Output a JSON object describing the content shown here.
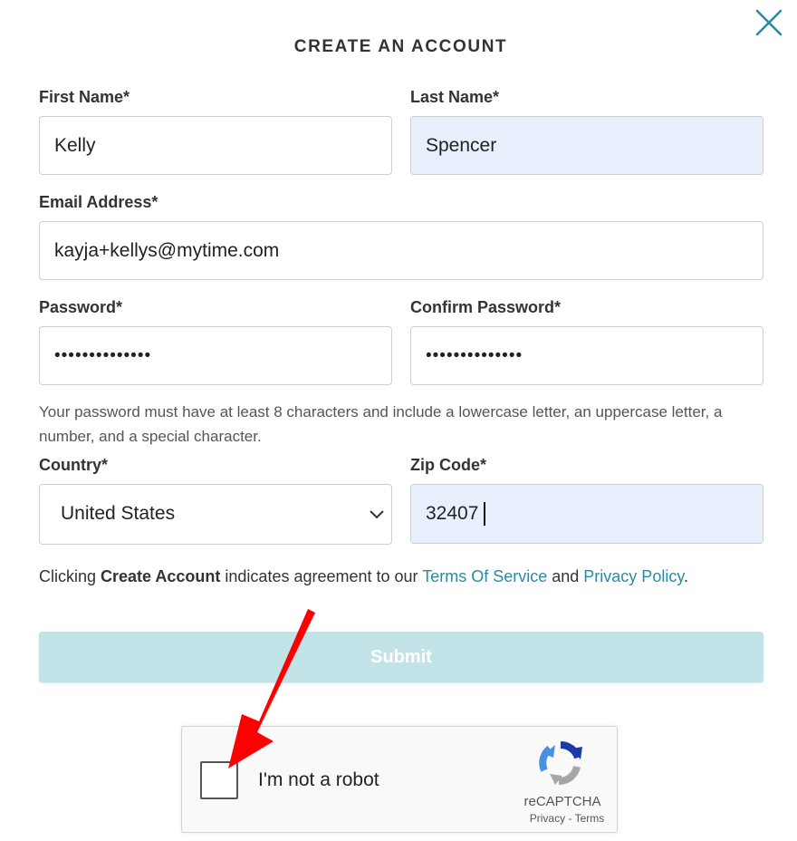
{
  "modal": {
    "title": "CREATE AN ACCOUNT",
    "close_icon": "close-icon"
  },
  "form": {
    "first_name": {
      "label": "First Name*",
      "value": "Kelly"
    },
    "last_name": {
      "label": "Last Name*",
      "value": "Spencer"
    },
    "email": {
      "label": "Email Address*",
      "value": "kayja+kellys@mytime.com"
    },
    "password": {
      "label": "Password*",
      "value": "••••••••••••••"
    },
    "confirm_password": {
      "label": "Confirm Password*",
      "value": "••••••••••••••"
    },
    "password_help": "Your password must have at least 8 characters and include a lowercase letter, an uppercase letter, a number, and a special character.",
    "country": {
      "label": "Country*",
      "value": "United States",
      "icon": "chevron-down-icon"
    },
    "zip": {
      "label": "Zip Code*",
      "value": "32407"
    }
  },
  "terms": {
    "prefix": "Clicking ",
    "bold": "Create Account",
    "middle": " indicates agreement to our ",
    "tos_link": "Terms Of Service",
    "and": " and ",
    "privacy_link": "Privacy Policy",
    "suffix": "."
  },
  "submit": {
    "label": "Submit"
  },
  "recaptcha": {
    "label": "I'm not a robot",
    "brand": "reCAPTCHA",
    "privacy": "Privacy",
    "separator": " - ",
    "terms": "Terms",
    "logo_icon": "recaptcha-logo-icon"
  },
  "colors": {
    "accent": "#2a8aa3",
    "autofill": "#e8f0fe",
    "submit_disabled": "#c2e3e8",
    "annotation_arrow": "#ff0000"
  },
  "annotation": {
    "icon": "red-arrow-icon"
  }
}
